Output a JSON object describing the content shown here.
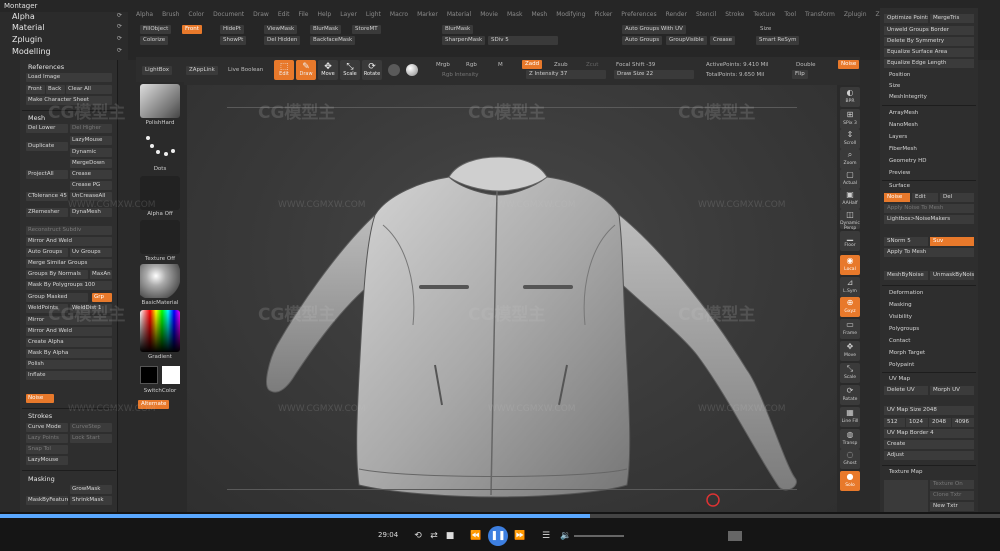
{
  "app": {
    "title": "Montager"
  },
  "menu": [
    "Alpha",
    "Brush",
    "Color",
    "Document",
    "Draw",
    "Edit",
    "File",
    "Help",
    "Layer",
    "Light",
    "Macro",
    "Marker",
    "Material",
    "Movie",
    "Mask",
    "Mesh",
    "Modifying",
    "Picker",
    "Preferences",
    "Render",
    "Stencil",
    "Stroke",
    "Texture",
    "Tool",
    "Transform",
    "Zplugin",
    "Zscript"
  ],
  "tree": [
    "Alpha",
    "Material",
    "Zplugin",
    "Modelling"
  ],
  "toolbar_row1": {
    "fill_object": "FillObject",
    "front": "Front",
    "view_mask": "ViewMask",
    "blur_mask": "BlurMask",
    "store_mt": "StoreMT",
    "colorize": "Colorize",
    "show_pt": "ShowPt",
    "del_hidden": "Del Hidden",
    "backface_mask": "BackfaceMask",
    "sharpen_mask": "SharpenMask",
    "sdiv": "SDiv 5",
    "auto_groups": "Auto Groups",
    "group_visible": "GroupVisible",
    "crease": "Crease",
    "smart_resym": "Smart ReSym",
    "auto_groups_uv": "Auto Groups With UV",
    "size": "Size",
    "hide_pt": "HidePt"
  },
  "toolbar2": {
    "lightbox": "LightBox",
    "zapplink": "ZAppLink",
    "live_boolean": "Live Boolean",
    "edit": "Edit",
    "draw": "Draw",
    "move": "Move",
    "scale": "Scale",
    "rotate": "Rotate",
    "mrgb": "Mrgb",
    "rgb": "Rgb",
    "m": "M",
    "zadd": "Zadd",
    "zsub": "Zsub",
    "zcut": "Zcut",
    "rgb_intensity": "Rgb Intensity",
    "z_intensity": "Z Intensity 37",
    "focal_shift": "Focal Shift -39",
    "draw_size": "Draw Size 22",
    "active_points": "ActivePoints: 9.410 Mil",
    "total_points": "TotalPoints: 9.650 Mil",
    "double": "Double",
    "flip": "Flip",
    "noise": "Noise"
  },
  "shelf": {
    "brush": "PolishHard",
    "stroke": "Dots",
    "alpha": "Alpha Off",
    "texture": "Texture Off",
    "material": "BasicMaterial",
    "gradient": "Gradient",
    "switch_color": "SwitchColor",
    "alternate": "Alternate"
  },
  "left_panel": {
    "references": "References",
    "load_image": "Load Image",
    "front": "Front",
    "back": "Back",
    "clear_all": "Clear All",
    "make_char_sheet": "Make Character Sheet",
    "mesh": "Mesh",
    "del_lower": "Del Lower",
    "del_higher": "Del Higher",
    "lazymouse": "LazyMouse",
    "duplicate": "Duplicate",
    "dynamic": "Dynamic",
    "mergedown": "MergeDown",
    "project_all": "ProjectAll",
    "crease": "Crease",
    "crease_pg": "Crease PG",
    "ctolerance": "CTolerance 45",
    "uncrease_all": "UnCreaseAll",
    "zremesher": "ZRemesher",
    "dynamesh": "DynaMesh",
    "reconstruct": "Reconstruct Subdiv",
    "mirror_weld": "Mirror And Weld",
    "auto_groups": "Auto Groups",
    "uv_groups": "Uv Groups",
    "merge_similar": "Merge Similar Groups",
    "groups_by_normals": "Groups By Normals",
    "max_angle": "MaxAn",
    "mask_by_polygroups": "Mask By Polygroups 100",
    "group_masked": "Group Masked",
    "grp": "Grp",
    "weld_points": "WeldPoints",
    "weld_dist": "WeldDist 1",
    "mirror": "Mirror",
    "mirror_and_weld": "Mirror And Weld",
    "create_alpha": "Create Alpha",
    "mask_by_alpha": "Mask By Alpha",
    "polish": "Polish",
    "inflate": "Inflate",
    "noise": "Noise",
    "strokes": "Strokes",
    "curve_mode": "Curve Mode",
    "curve_step": "CurveStep",
    "lazy_points": "Lazy Points",
    "lock_start": "Lock Start",
    "snap_tol": "Snap Tol",
    "lazymouse2": "LazyMouse",
    "masking": "Masking",
    "grow_mask": "GrowMask",
    "mask_by_feature": "MaskByFeature",
    "shrink_mask": "ShrinkMask"
  },
  "right_shelf": [
    "BPR",
    "SPix 3",
    "Scroll",
    "Zoom",
    "Actual",
    "AAHalf",
    "Dynamic Persp",
    "Floor",
    "Local",
    "L.Sym",
    "Gxyz",
    "Frame",
    "Move",
    "Scale",
    "Rotate",
    "Line Fill",
    "Transp",
    "Ghost",
    "Solo"
  ],
  "right_panel": {
    "optimize_points": "Optimize Points",
    "merge_tris": "MergeTris",
    "unweld_groups": "Unweld Groups Border",
    "delete_by_symmetry": "Delete By Symmetry",
    "equalize_surface": "Equalize Surface Area",
    "equalize_edge": "Equalize Edge Length",
    "position": "Position",
    "size": "Size",
    "mesh_integrity": "MeshIntegrity",
    "array_mesh": "ArrayMesh",
    "nano_mesh": "NanoMesh",
    "layers": "Layers",
    "fiber_mesh": "FiberMesh",
    "geometry_hd": "Geometry HD",
    "preview": "Preview",
    "surface": "Surface",
    "noise": "Noise",
    "edit": "Edit",
    "del": "Del",
    "apply_to_mesh_noise": "Apply Noise To Mesh",
    "lightbox_noisemakers": "Lightbox>NoiseMakers",
    "snorm": "SNorm 5",
    "suv": "Suv",
    "apply_to_mesh": "Apply To Mesh",
    "mesh_by_noise": "MeshByNoise",
    "unmask_by_noise": "UnmaskByNoise",
    "deformation": "Deformation",
    "masking": "Masking",
    "visibility": "Visibility",
    "polygroups": "Polygroups",
    "contact": "Contact",
    "morph_target": "Morph Target",
    "polypaint": "Polypaint",
    "uv_map": "UV Map",
    "delete_uv": "Delete UV",
    "morph_uv": "Morph UV",
    "uv_map_size": "UV Map Size 2048",
    "s512": "512",
    "s1024": "1024",
    "s2048": "2048",
    "s4096": "4096",
    "uv_map_border": "UV Map Border 4",
    "create": "Create",
    "adjust": "Adjust",
    "texture_map": "Texture Map",
    "texture_on": "Texture On",
    "clone_txtr": "Clone Txtr",
    "new_txtr": "New Txtr"
  },
  "player": {
    "time": "29:04",
    "progress_fraction": 0.59
  },
  "watermark": {
    "brand": "CG模型主",
    "url": "WWW.CGMXW.COM"
  }
}
